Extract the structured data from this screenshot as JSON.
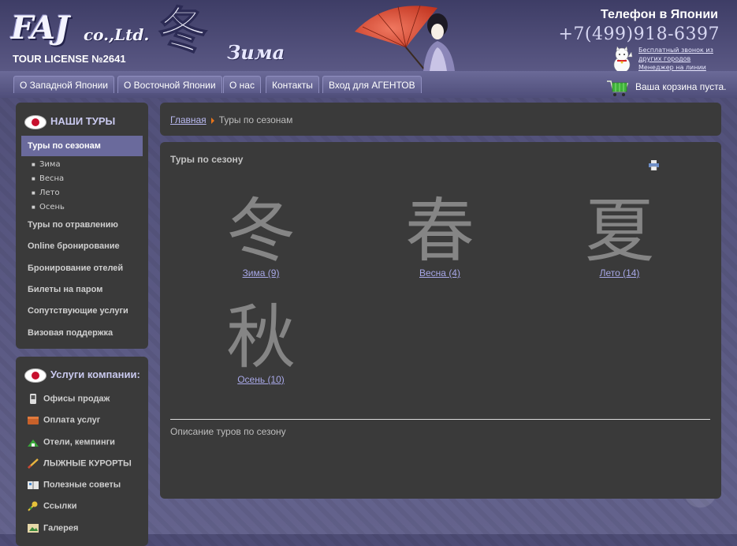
{
  "header": {
    "logo_main": "FAJ",
    "logo_suffix": "co.,Ltd.",
    "license": "TOUR LICENSE №2641",
    "logo_kanji": "冬",
    "season_title": "Зима",
    "phone_label": "Телефон в Японии",
    "phone_number": "+7(499)918-6397",
    "callback_lines": [
      "Бесплатный звонок из",
      "других городов",
      "Менеджер на линии"
    ]
  },
  "topnav": {
    "tabs": [
      {
        "label": "О Западной Японии"
      },
      {
        "label": "О Восточной Японии"
      },
      {
        "label": "О нас"
      },
      {
        "label": "Контакты"
      },
      {
        "label": "Вход для АГЕНТОВ"
      }
    ],
    "cart_text": "Ваша корзина пуста."
  },
  "sidebar": {
    "tours_title": "НАШИ ТУРЫ",
    "tours_items": [
      {
        "label": "Туры по сезонам",
        "active": true
      },
      {
        "label": "Туры по отравлению"
      },
      {
        "label": "Online бронирование"
      },
      {
        "label": "Бронирование отелей"
      },
      {
        "label": "Билеты на паром"
      },
      {
        "label": "Сопутствующие услуги"
      },
      {
        "label": "Визовая поддержка"
      }
    ],
    "season_subitems": [
      "Зима",
      "Весна",
      "Лето",
      "Осень"
    ],
    "services_title": "Услуги компании:",
    "services_items": [
      {
        "label": "Офисы продаж",
        "icon": "phone-icon"
      },
      {
        "label": "Оплата услуг",
        "icon": "wallet-icon"
      },
      {
        "label": "Отели, кемпинги",
        "icon": "hotel-icon"
      },
      {
        "label": "ЛЫЖНЫЕ КУРОРТЫ",
        "icon": "ski-icon"
      },
      {
        "label": "Полезные советы",
        "icon": "book-icon"
      },
      {
        "label": "Ссылки",
        "icon": "link-icon"
      },
      {
        "label": "Галерея",
        "icon": "gallery-icon"
      }
    ]
  },
  "breadcrumb": {
    "home": "Главная",
    "current": "Туры по сезонам"
  },
  "content": {
    "title": "Туры по сезону",
    "seasons": [
      {
        "kanji": "冬",
        "label": "Зима (9)"
      },
      {
        "kanji": "春",
        "label": "Весна (4)"
      },
      {
        "kanji": "夏",
        "label": "Лето (14)"
      },
      {
        "kanji": "秋",
        "label": "Осень (10)"
      }
    ],
    "description": "Описание туров по сезону"
  },
  "colors": {
    "accent": "#6a6a9c",
    "panel": "#3a3a3a",
    "link": "#a7a7e6",
    "breadcrumb_arrow": "#e8741a"
  }
}
